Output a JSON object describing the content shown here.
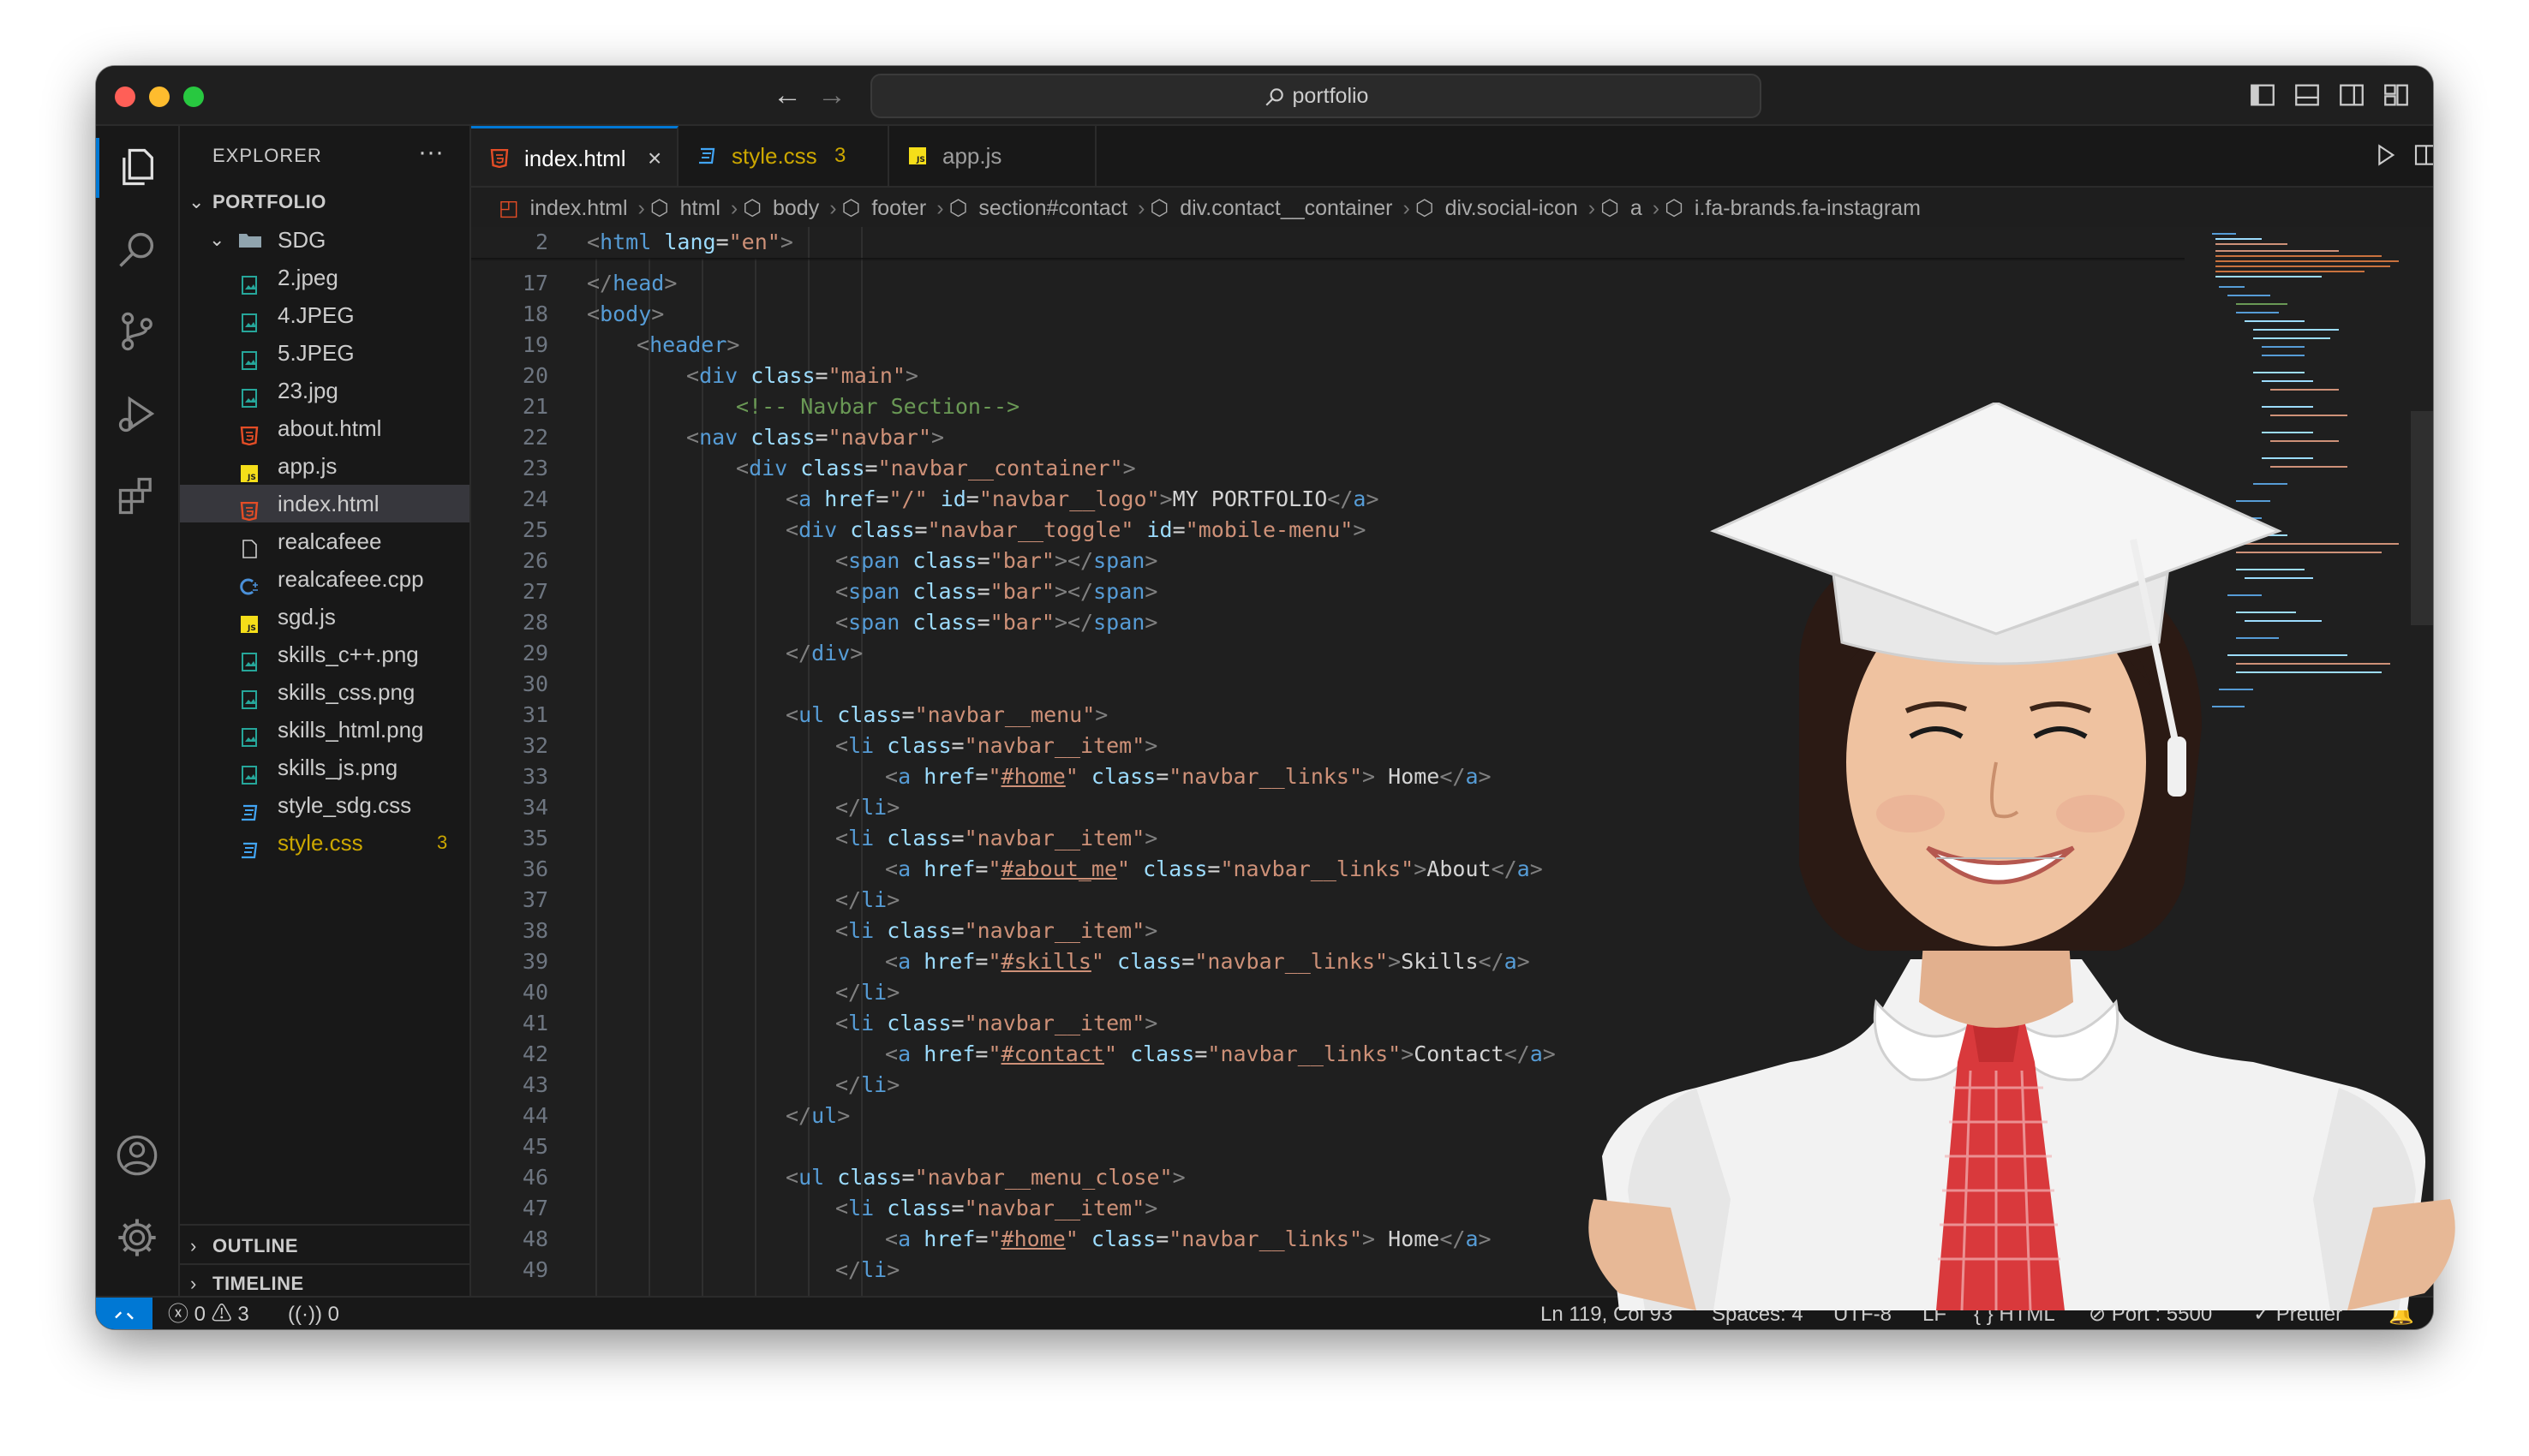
{
  "titlebar": {
    "search_text": "portfolio"
  },
  "sidebar": {
    "title": "EXPLORER",
    "more": "···",
    "root": "PORTFOLIO",
    "folder": "SDG",
    "files": [
      {
        "name": "2.jpeg",
        "type": "image"
      },
      {
        "name": "4.JPEG",
        "type": "image"
      },
      {
        "name": "5.JPEG",
        "type": "image"
      },
      {
        "name": "23.jpg",
        "type": "image"
      },
      {
        "name": "about.html",
        "type": "html"
      },
      {
        "name": "app.js",
        "type": "js"
      },
      {
        "name": "index.html",
        "type": "html"
      },
      {
        "name": "realcafeee",
        "type": "file"
      },
      {
        "name": "realcafeee.cpp",
        "type": "cpp"
      },
      {
        "name": "sgd.js",
        "type": "js"
      },
      {
        "name": "skills_c++.png",
        "type": "image"
      },
      {
        "name": "skills_css.png",
        "type": "image"
      },
      {
        "name": "skills_html.png",
        "type": "image"
      },
      {
        "name": "skills_js.png",
        "type": "image"
      },
      {
        "name": "style_sdg.css",
        "type": "css"
      },
      {
        "name": "style.css",
        "type": "css"
      }
    ],
    "style_badge": "3",
    "outline": "OUTLINE",
    "timeline": "TIMELINE"
  },
  "tabs": [
    {
      "label": "index.html",
      "close": "×"
    },
    {
      "label": "style.css",
      "badge": "3"
    },
    {
      "label": "app.js"
    }
  ],
  "breadcrumbs": [
    "index.html",
    "html",
    "body",
    "footer",
    "section#contact",
    "div.contact__container",
    "div.social-icon",
    "a",
    "i.fa-brands.fa-instagram"
  ],
  "editor": {
    "lines": [
      {
        "n": "2",
        "html": "<span class=\"brk\">&lt;</span><span class=\"tag\">html</span> <span class=\"attr\">lang</span>=<span class=\"str\">\"en\"</span><span class=\"brk\">&gt;</span>",
        "indent": 0
      },
      {
        "n": "17",
        "html": "<span class=\"brk\">&lt;/</span><span class=\"tag\">head</span><span class=\"brk\">&gt;</span>",
        "indent": 0
      },
      {
        "n": "18",
        "html": "<span class=\"brk\">&lt;</span><span class=\"tag\">body</span><span class=\"brk\">&gt;</span>",
        "indent": 0
      },
      {
        "n": "19",
        "html": "<span class=\"brk\">&lt;</span><span class=\"tag\">header</span><span class=\"brk\">&gt;</span>",
        "indent": 1
      },
      {
        "n": "20",
        "html": "<span class=\"brk\">&lt;</span><span class=\"tag\">div</span> <span class=\"attr\">class</span>=<span class=\"str\">\"main\"</span><span class=\"brk\">&gt;</span>",
        "indent": 2
      },
      {
        "n": "21",
        "html": "<span class=\"cmt\">&lt;!-- Navbar Section--&gt;</span>",
        "indent": 3
      },
      {
        "n": "22",
        "html": "<span class=\"brk\">&lt;</span><span class=\"tag\">nav</span> <span class=\"attr\">class</span>=<span class=\"str\">\"navbar\"</span><span class=\"brk\">&gt;</span>",
        "indent": 2
      },
      {
        "n": "23",
        "html": "<span class=\"brk\">&lt;</span><span class=\"tag\">div</span> <span class=\"attr\">class</span>=<span class=\"str\">\"navbar__container\"</span><span class=\"brk\">&gt;</span>",
        "indent": 3
      },
      {
        "n": "24",
        "html": "<span class=\"brk\">&lt;</span><span class=\"tag\">a</span> <span class=\"attr\">href</span>=<span class=\"str\">\"/\"</span> <span class=\"attr\">id</span>=<span class=\"str\">\"navbar__logo\"</span><span class=\"brk\">&gt;</span><span class=\"txt\">MY PORTFOLIO</span><span class=\"brk\">&lt;/</span><span class=\"tag\">a</span><span class=\"brk\">&gt;</span>",
        "indent": 4
      },
      {
        "n": "25",
        "html": "<span class=\"brk\">&lt;</span><span class=\"tag\">div</span> <span class=\"attr\">class</span>=<span class=\"str\">\"navbar__toggle\"</span> <span class=\"attr\">id</span>=<span class=\"str\">\"mobile-menu\"</span><span class=\"brk\">&gt;</span>",
        "indent": 4
      },
      {
        "n": "26",
        "html": "<span class=\"brk\">&lt;</span><span class=\"tag\">span</span> <span class=\"attr\">class</span>=<span class=\"str\">\"bar\"</span><span class=\"brk\">&gt;&lt;/</span><span class=\"tag\">span</span><span class=\"brk\">&gt;</span>",
        "indent": 5
      },
      {
        "n": "27",
        "html": "<span class=\"brk\">&lt;</span><span class=\"tag\">span</span> <span class=\"attr\">class</span>=<span class=\"str\">\"bar\"</span><span class=\"brk\">&gt;&lt;/</span><span class=\"tag\">span</span><span class=\"brk\">&gt;</span>",
        "indent": 5
      },
      {
        "n": "28",
        "html": "<span class=\"brk\">&lt;</span><span class=\"tag\">span</span> <span class=\"attr\">class</span>=<span class=\"str\">\"bar\"</span><span class=\"brk\">&gt;&lt;/</span><span class=\"tag\">span</span><span class=\"brk\">&gt;</span>",
        "indent": 5
      },
      {
        "n": "29",
        "html": "<span class=\"brk\">&lt;/</span><span class=\"tag\">div</span><span class=\"brk\">&gt;</span>",
        "indent": 4
      },
      {
        "n": "30",
        "html": "",
        "indent": 0
      },
      {
        "n": "31",
        "html": "<span class=\"brk\">&lt;</span><span class=\"tag\">ul</span> <span class=\"attr\">class</span>=<span class=\"str\">\"navbar__menu\"</span><span class=\"brk\">&gt;</span>",
        "indent": 4
      },
      {
        "n": "32",
        "html": "<span class=\"brk\">&lt;</span><span class=\"tag\">li</span> <span class=\"attr\">class</span>=<span class=\"str\">\"navbar__item\"</span><span class=\"brk\">&gt;</span>",
        "indent": 5
      },
      {
        "n": "33",
        "html": "<span class=\"brk\">&lt;</span><span class=\"tag\">a</span> <span class=\"attr\">href</span>=<span class=\"str\">\"</span><span class=\"link\">#home</span><span class=\"str\">\"</span> <span class=\"attr\">class</span>=<span class=\"str\">\"navbar__links\"</span><span class=\"brk\">&gt;</span><span class=\"txt\"> Home</span><span class=\"brk\">&lt;/</span><span class=\"tag\">a</span><span class=\"brk\">&gt;</span>",
        "indent": 6
      },
      {
        "n": "34",
        "html": "<span class=\"brk\">&lt;/</span><span class=\"tag\">li</span><span class=\"brk\">&gt;</span>",
        "indent": 5
      },
      {
        "n": "35",
        "html": "<span class=\"brk\">&lt;</span><span class=\"tag\">li</span> <span class=\"attr\">class</span>=<span class=\"str\">\"navbar__item\"</span><span class=\"brk\">&gt;</span>",
        "indent": 5
      },
      {
        "n": "36",
        "html": "<span class=\"brk\">&lt;</span><span class=\"tag\">a</span> <span class=\"attr\">href</span>=<span class=\"str\">\"</span><span class=\"link\">#about_me</span><span class=\"str\">\"</span> <span class=\"attr\">class</span>=<span class=\"str\">\"navbar__links\"</span><span class=\"brk\">&gt;</span><span class=\"txt\">About</span><span class=\"brk\">&lt;/</span><span class=\"tag\">a</span><span class=\"brk\">&gt;</span>",
        "indent": 6
      },
      {
        "n": "37",
        "html": "<span class=\"brk\">&lt;/</span><span class=\"tag\">li</span><span class=\"brk\">&gt;</span>",
        "indent": 5
      },
      {
        "n": "38",
        "html": "<span class=\"brk\">&lt;</span><span class=\"tag\">li</span> <span class=\"attr\">class</span>=<span class=\"str\">\"navbar__item\"</span><span class=\"brk\">&gt;</span>",
        "indent": 5
      },
      {
        "n": "39",
        "html": "<span class=\"brk\">&lt;</span><span class=\"tag\">a</span> <span class=\"attr\">href</span>=<span class=\"str\">\"</span><span class=\"link\">#skills</span><span class=\"str\">\"</span> <span class=\"attr\">class</span>=<span class=\"str\">\"navbar__links\"</span><span class=\"brk\">&gt;</span><span class=\"txt\">Skills</span><span class=\"brk\">&lt;/</span><span class=\"tag\">a</span><span class=\"brk\">&gt;</span>",
        "indent": 6
      },
      {
        "n": "40",
        "html": "<span class=\"brk\">&lt;/</span><span class=\"tag\">li</span><span class=\"brk\">&gt;</span>",
        "indent": 5
      },
      {
        "n": "41",
        "html": "<span class=\"brk\">&lt;</span><span class=\"tag\">li</span> <span class=\"attr\">class</span>=<span class=\"str\">\"navbar__item\"</span><span class=\"brk\">&gt;</span>",
        "indent": 5
      },
      {
        "n": "42",
        "html": "<span class=\"brk\">&lt;</span><span class=\"tag\">a</span> <span class=\"attr\">href</span>=<span class=\"str\">\"</span><span class=\"link\">#contact</span><span class=\"str\">\"</span> <span class=\"attr\">class</span>=<span class=\"str\">\"navbar__links\"</span><span class=\"brk\">&gt;</span><span class=\"txt\">Contact</span><span class=\"brk\">&lt;/</span><span class=\"tag\">a</span><span class=\"brk\">&gt;</span>",
        "indent": 6
      },
      {
        "n": "43",
        "html": "<span class=\"brk\">&lt;/</span><span class=\"tag\">li</span><span class=\"brk\">&gt;</span>",
        "indent": 5
      },
      {
        "n": "44",
        "html": "<span class=\"brk\">&lt;/</span><span class=\"tag\">ul</span><span class=\"brk\">&gt;</span>",
        "indent": 4
      },
      {
        "n": "45",
        "html": "",
        "indent": 0
      },
      {
        "n": "46",
        "html": "<span class=\"brk\">&lt;</span><span class=\"tag\">ul</span> <span class=\"attr\">class</span>=<span class=\"str\">\"navbar__menu_close\"</span><span class=\"brk\">&gt;</span>",
        "indent": 4
      },
      {
        "n": "47",
        "html": "<span class=\"brk\">&lt;</span><span class=\"tag\">li</span> <span class=\"attr\">class</span>=<span class=\"str\">\"navbar__item\"</span><span class=\"brk\">&gt;</span>",
        "indent": 5
      },
      {
        "n": "48",
        "html": "<span class=\"brk\">&lt;</span><span class=\"tag\">a</span> <span class=\"attr\">href</span>=<span class=\"str\">\"</span><span class=\"link\">#home</span><span class=\"str\">\"</span> <span class=\"attr\">class</span>=<span class=\"str\">\"navbar__links\"</span><span class=\"brk\">&gt;</span><span class=\"txt\"> Home</span><span class=\"brk\">&lt;/</span><span class=\"tag\">a</span><span class=\"brk\">&gt;</span>",
        "indent": 6
      },
      {
        "n": "49",
        "html": "<span class=\"brk\">&lt;/</span><span class=\"tag\">li</span><span class=\"brk\">&gt;</span>",
        "indent": 5
      }
    ]
  },
  "statusbar": {
    "errors": "0",
    "warnings": "3",
    "ports": "0",
    "position": "Ln 119, Col 93",
    "spaces": "Spaces: 4",
    "encoding": "UTF-8",
    "eol": "LF",
    "language": "HTML",
    "port": "Port : 5500",
    "formatter": "Prettier"
  },
  "colors": {
    "accent": "#0078d4",
    "html_icon": "#e44d26",
    "css_icon": "#42a5f5",
    "js_icon": "#f5de19",
    "image_icon": "#26a69a",
    "cpp_icon": "#4a90d9",
    "warning_file": "#cca700"
  }
}
